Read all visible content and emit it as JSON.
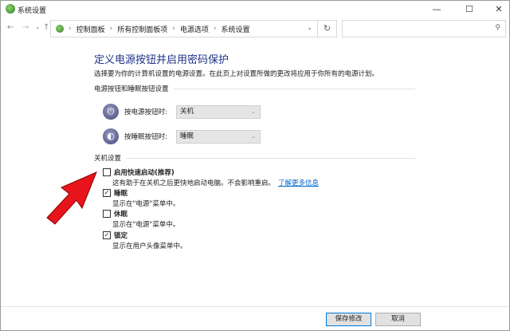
{
  "window": {
    "title": "系统设置",
    "minimize": "—",
    "maximize": "☐",
    "close": "✕"
  },
  "nav": {
    "back": "←",
    "forward": "→",
    "recent": "⌄",
    "up": "↑",
    "breadcrumb": [
      "控制面板",
      "所有控制面板项",
      "电源选项",
      "系统设置"
    ],
    "separator": "›",
    "dropdown": "⌄",
    "refresh": "↻",
    "search_icon": "⚲",
    "search_placeholder": ""
  },
  "page": {
    "title": "定义电源按钮并启用密码保护",
    "description": "选择要为你的计算机设置的电源设置。在此页上对设置所做的更改将应用于你所有的电源计划。"
  },
  "buttons_group": {
    "label": "电源按钮和睡眠按钮设置",
    "power": {
      "label": "按电源按钮时:",
      "value": "关机"
    },
    "sleep": {
      "label": "按睡眠按钮时:",
      "value": "睡眠"
    }
  },
  "shutdown_group": {
    "label": "关机设置",
    "items": [
      {
        "label": "启用快速启动(推荐)",
        "checked": false,
        "desc": "这有助于在关机之后更快地启动电脑。不会影响重启。",
        "link": "了解更多信息"
      },
      {
        "label": "睡眠",
        "checked": true,
        "desc": "显示在\"电源\"菜单中。"
      },
      {
        "label": "休眠",
        "checked": false,
        "desc": "显示在\"电源\"菜单中。"
      },
      {
        "label": "锁定",
        "checked": true,
        "desc": "显示在用户头像菜单中。"
      }
    ]
  },
  "footer": {
    "save": "保存修改",
    "cancel": "取消"
  },
  "colors": {
    "title": "#1e3287",
    "link": "#0066cc",
    "arrow": "#e8141b"
  }
}
